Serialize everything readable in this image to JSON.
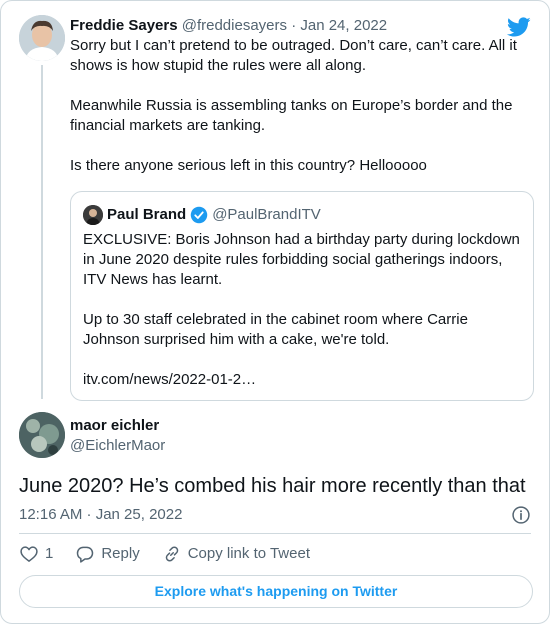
{
  "tweet": {
    "author_name": "Freddie Sayers",
    "author_handle": "@freddiesayers",
    "separator": "·",
    "date": "Jan 24, 2022",
    "paragraphs": [
      "Sorry but I can’t pretend to be outraged. Don’t care, can’t care. All it shows is how stupid the rules were all along.",
      "Meanwhile Russia is assembling tanks on Europe’s border and the financial markets are tanking.",
      "Is there anyone serious left in this country? Hellooooo"
    ]
  },
  "quoted": {
    "author_name": "Paul Brand",
    "author_handle": "@PaulBrandITV",
    "paragraphs": [
      "EXCLUSIVE: Boris Johnson had a birthday party during lockdown in June 2020 despite rules forbidding social gatherings indoors, ITV News has learnt.",
      "Up to 30 staff celebrated in the cabinet room where Carrie Johnson surprised him with a cake, we're told.",
      "itv.com/news/2022-01-2…"
    ]
  },
  "reply": {
    "author_name": "maor eichler",
    "author_handle": "@EichlerMaor",
    "text": "June 2020? He’s combed his hair more recently than that",
    "timestamp": "12:16 AM · Jan 25, 2022"
  },
  "actions": {
    "like_count": "1",
    "reply_label": "Reply",
    "copy_link_label": "Copy link to Tweet"
  },
  "explore_label": "Explore what's happening on Twitter",
  "colors": {
    "accent": "#1d9bf0",
    "muted": "#536471",
    "border": "#cfd9de"
  }
}
